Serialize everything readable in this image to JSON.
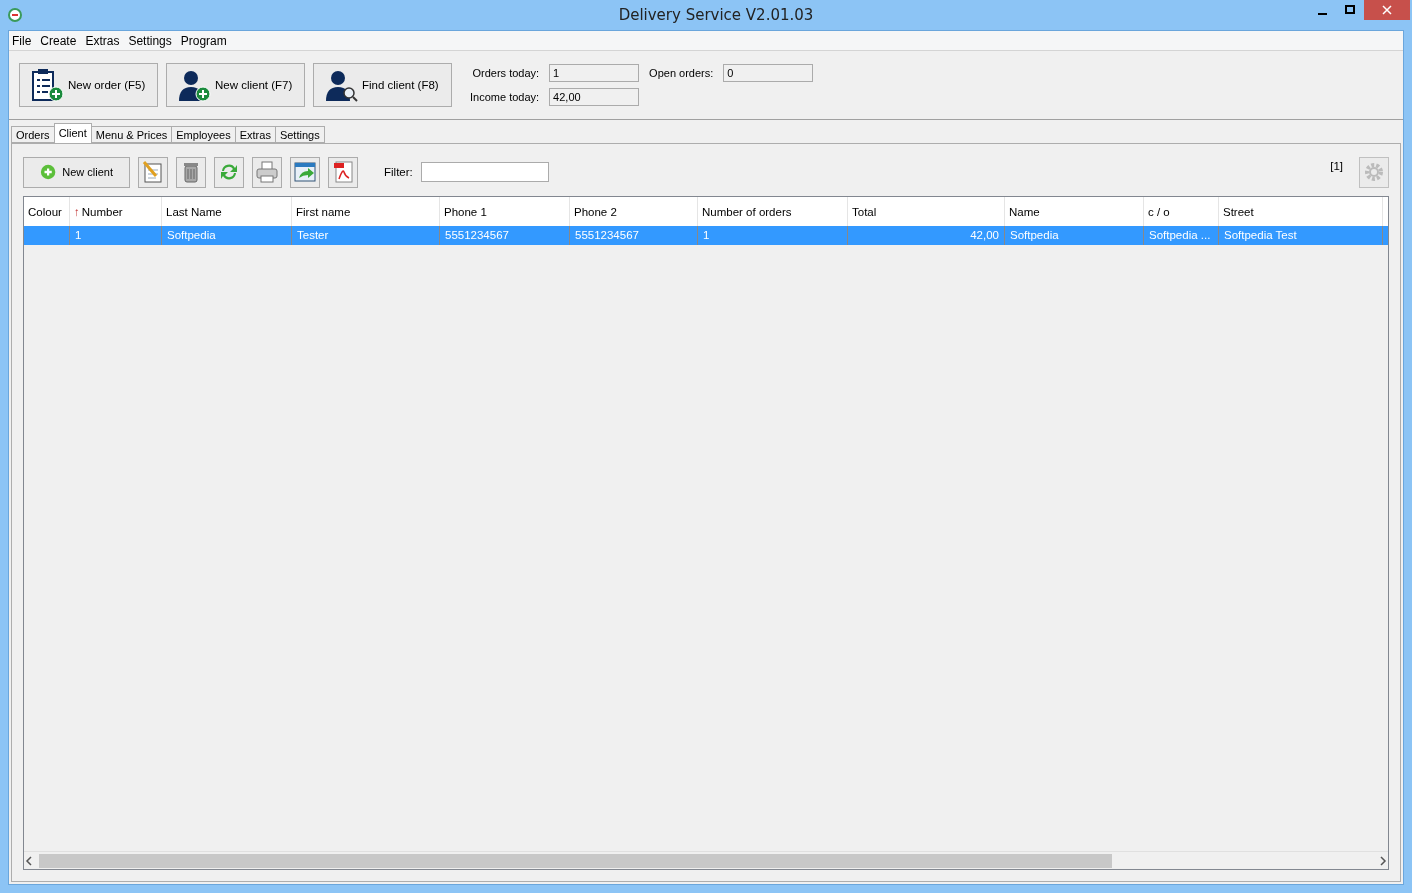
{
  "window": {
    "title": "Delivery Service V2.01.03"
  },
  "menu": [
    "File",
    "Create",
    "Extras",
    "Settings",
    "Program"
  ],
  "main_buttons": [
    {
      "label": "New order (F5)",
      "kind": "order"
    },
    {
      "label": "New client (F7)",
      "kind": "add-client"
    },
    {
      "label": "Find client (F8)",
      "kind": "find-client"
    }
  ],
  "stats": [
    {
      "label": "Orders today:",
      "value": "1"
    },
    {
      "label": "Income today:",
      "value": "42,00"
    },
    {
      "label": "Open orders:",
      "value": "0"
    }
  ],
  "tabs": [
    {
      "label": "Orders",
      "selected": false
    },
    {
      "label": "Client",
      "selected": true
    },
    {
      "label": "Menu & Prices",
      "selected": false
    },
    {
      "label": "Employees",
      "selected": false
    },
    {
      "label": "Extras",
      "selected": false
    },
    {
      "label": "Settings",
      "selected": false
    }
  ],
  "toolbar": {
    "new_button": "New client",
    "tools": [
      {
        "kind": "edit"
      },
      {
        "kind": "delete"
      },
      {
        "kind": "refresh"
      },
      {
        "kind": "print"
      },
      {
        "kind": "export"
      },
      {
        "kind": "pdf"
      }
    ],
    "filter_label": "Filter:",
    "count": "[1]"
  },
  "table": {
    "columns": [
      {
        "label": "Colour",
        "kind": "text"
      },
      {
        "label": "Number",
        "kind": "text",
        "sort": "↑"
      },
      {
        "label": "Last Name",
        "kind": "text"
      },
      {
        "label": "First name",
        "kind": "text"
      },
      {
        "label": "Phone 1",
        "kind": "text"
      },
      {
        "label": "Phone 2",
        "kind": "text"
      },
      {
        "label": "Number of orders",
        "kind": "text"
      },
      {
        "label": "Total",
        "kind": "number"
      },
      {
        "label": "Name",
        "kind": "text"
      },
      {
        "label": "c / o",
        "kind": "text"
      },
      {
        "label": "Street",
        "kind": "text"
      }
    ],
    "rows": [
      {
        "selected": true,
        "cells": [
          "",
          "1",
          "Softpedia",
          "Tester",
          "5551234567",
          "5551234567",
          "1",
          "42,00",
          "Softpedia",
          "Softpedia ...",
          "Softpedia Test"
        ]
      }
    ]
  }
}
